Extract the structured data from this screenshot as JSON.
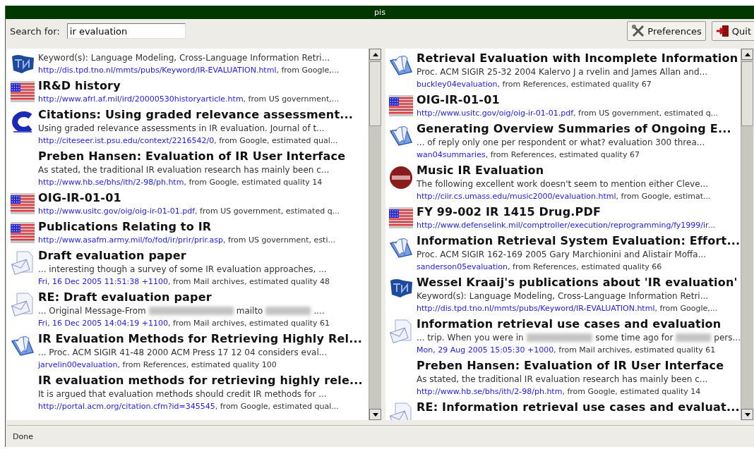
{
  "window": {
    "title": "pis"
  },
  "toolbar": {
    "search_label": "Search for:",
    "search_value": "ir evaluation",
    "buttons": [
      {
        "kind": "preferences",
        "label": "Preferences"
      },
      {
        "kind": "quit",
        "label": "Quit"
      }
    ]
  },
  "panes": [
    {
      "results": [
        {
          "kind": "tno",
          "snippet": "Keyword(s): Language Modeling, Cross-Language Information Retri...",
          "link": "http://dis.tpd.tno.nl/mmts/pubs/Keyword/IR-EVALUATION.html",
          "meta": ", from Google,..."
        },
        {
          "kind": "flag",
          "title": "IR&D history",
          "link": "http://www.afrl.af.mil/ird/20000530historyarticle.htm",
          "meta": ", from US government,..."
        },
        {
          "kind": "citeseer",
          "title": "Citations: Using graded relevance assessment...",
          "snippet": "Using graded relevance assessments in IR evaluation. Journal of t...",
          "link": "http://citeseer.ist.psu.edu/context/2216542/0",
          "meta": ", from Google, estimated qual..."
        },
        {
          "kind": "none",
          "title": "Preben Hansen: Evaluation of IR User Interface",
          "snippet": "As stated, the traditional IR evaluation research has mainly been c...",
          "link": "http://www.hb.se/bhs/ith/2-98/ph.htm",
          "meta": ", from Google, estimated quality 14"
        },
        {
          "kind": "flag",
          "title": "OIG-IR-01-01",
          "link": "http://www.usitc.gov/oig/oig-ir-01-01.pdf",
          "meta": ", from US government, estimated q..."
        },
        {
          "kind": "flag",
          "title": "Publications Relating to IR",
          "link": "http://www.asafm.army.mil/fo/fod/ir/prir/prir.asp",
          "meta": ", from US government, esti..."
        },
        {
          "kind": "mail",
          "title": "Draft evaluation paper",
          "snippet": "... interesting though a survey of some IR evaluation approaches, ...",
          "link": "Fri, 16 Dec 2005 11:51:38 +1100",
          "meta": ", from Mail archives, estimated quality 48"
        },
        {
          "kind": "mail",
          "title": "RE: Draft evaluation paper",
          "snippet_parts": [
            {
              "kind": "text",
              "text": "... Original Message-From"
            },
            {
              "kind": "redacted"
            },
            {
              "kind": "text",
              "text": "mailto"
            },
            {
              "kind": "redacted"
            },
            {
              "kind": "text",
              "text": "...."
            }
          ],
          "link": "Fri, 16 Dec 2005 14:04:19 +1100",
          "meta": ", from Mail archives, estimated quality 61"
        },
        {
          "kind": "book",
          "title": "IR Evaluation Methods for Retrieving Highly Rel...",
          "snippet": "... Proc. ACM SIGIR 41-48 2000 ACM Press 17 12 04 considers eval...",
          "link": "jarvelin00evaluation",
          "meta": ", from References, estimated quality 100"
        },
        {
          "kind": "none",
          "title": "IR evaluation methods for retrieving highly rele...",
          "snippet": "It is argued that evaluation methods should credit IR methods for ...",
          "link": "http://portal.acm.org/citation.cfm?id=345545",
          "meta": ", from Google, estimated qual..."
        }
      ]
    },
    {
      "results": [
        {
          "kind": "book",
          "title": "Retrieval Evaluation with Incomplete Information",
          "snippet": "Proc. ACM SIGIR 25-32 2004 Kalervo J a rvelin and James Allan and...",
          "link": "buckley04evaluation",
          "meta": ", from References, estimated quality 67"
        },
        {
          "kind": "flag",
          "title": "OIG-IR-01-01",
          "link": "http://www.usitc.gov/oig/oig-ir-01-01.pdf",
          "meta": ", from US government, estimated q..."
        },
        {
          "kind": "book",
          "title": "Generating Overview Summaries of Ongoing E...",
          "snippet": "... of reply only one per respondent or what? evaluation 300 threa...",
          "link": "wan04summaries",
          "meta": ", from References, estimated quality 67"
        },
        {
          "kind": "ciir",
          "title": "Music IR Evaluation",
          "snippet": "The following excellent work doesn't seem to mention either Cleve...",
          "link": "http://ciir.cs.umass.edu/music2000/evaluation.html",
          "meta": ", from Google, estimat..."
        },
        {
          "kind": "flag",
          "title": "FY 99-002 IR 1415 Drug.PDF",
          "link": "http://www.defenselink.mil/comptroller/execution/reprogramming/fy1999/ir..."
        },
        {
          "kind": "book",
          "title": "Information Retrieval System Evaluation: Effort...",
          "snippet": "Proc. ACM SIGIR 162-169 2005 Gary Marchionini and Alistair Moffa...",
          "link": "sanderson05evaluation",
          "meta": ", from References, estimated quality 66"
        },
        {
          "kind": "tno",
          "title": "Wessel Kraaij's publications about 'IR evaluation'",
          "snippet": "Keyword(s): Language Modeling, Cross-Language Information Retri...",
          "link": "http://dis.tpd.tno.nl/mmts/pubs/Keyword/IR-EVALUATION.html",
          "meta": ", from Google,..."
        },
        {
          "kind": "mail",
          "title": "Information retrieval use cases and evaluation",
          "snippet_parts": [
            {
              "kind": "text",
              "text": "... trip. When you were in"
            },
            {
              "kind": "redacted"
            },
            {
              "kind": "text",
              "text": "some time ago for"
            },
            {
              "kind": "redacted"
            },
            {
              "kind": "text",
              "text": "pers..."
            }
          ],
          "link": "Mon, 29 Aug 2005 15:05:30 +1000",
          "meta": ", from Mail archives, estimated quality 61"
        },
        {
          "kind": "none",
          "title": "Preben Hansen: Evaluation of IR User Interface",
          "snippet": "As stated, the traditional IR evaluation research has mainly been c...",
          "link": "http://www.hb.se/bhs/ith/2-98/ph.htm",
          "meta": ", from Google, estimated quality 14"
        },
        {
          "kind": "mail",
          "title": "RE: Information retrieval use cases and evaluat..."
        }
      ]
    }
  ],
  "status_bar": {
    "text": "Done"
  }
}
